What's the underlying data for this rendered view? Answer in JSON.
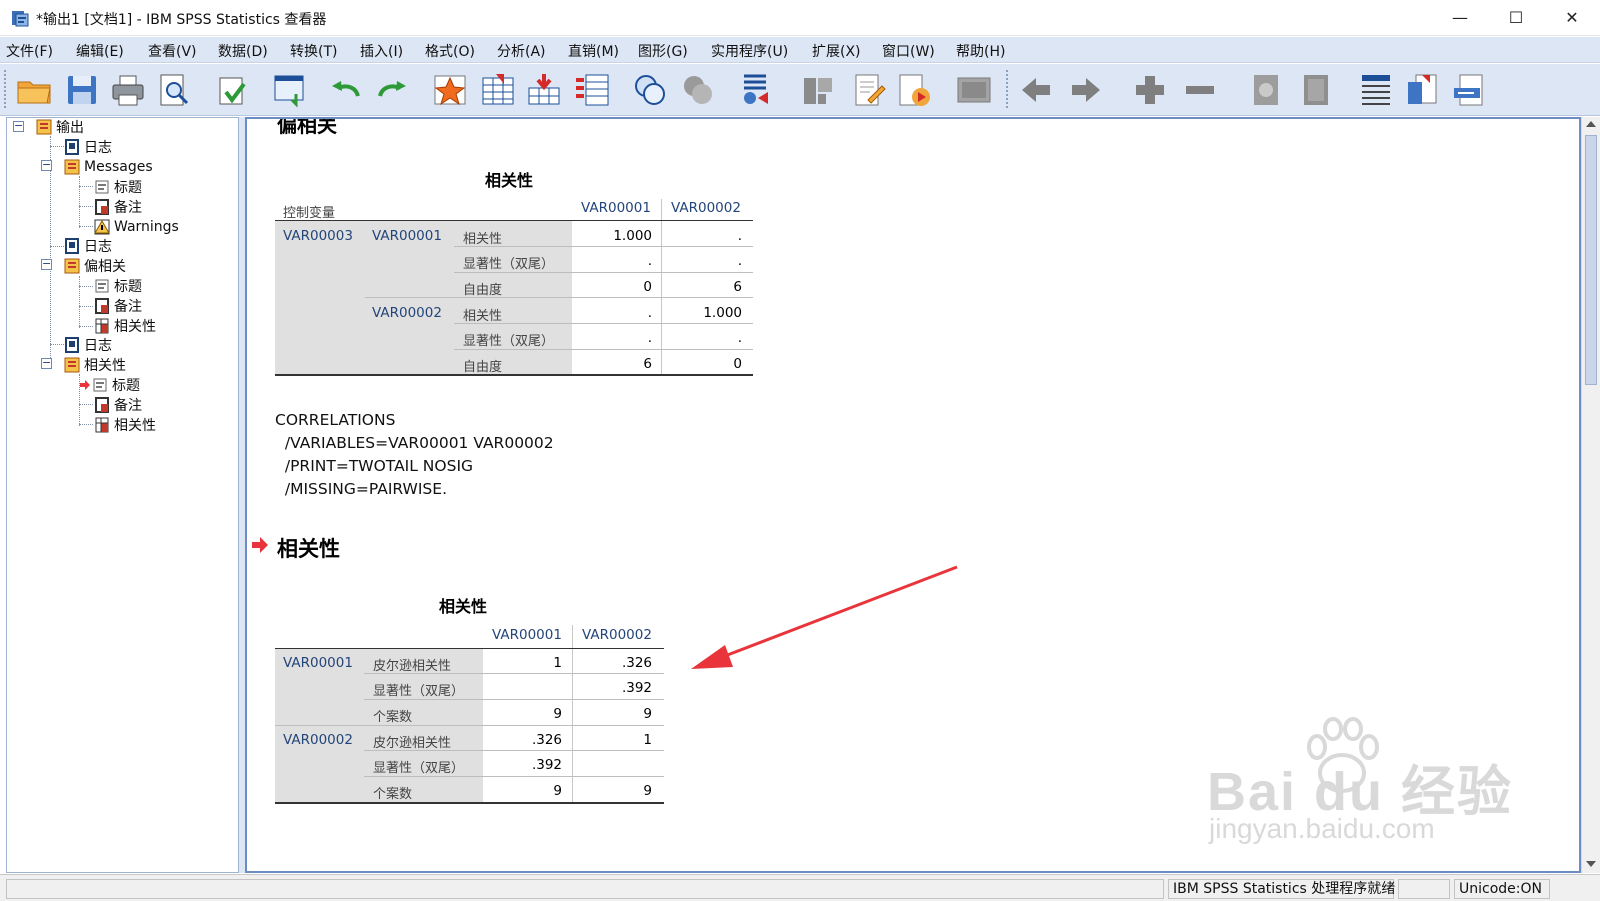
{
  "window": {
    "title": "*输出1 [文档1] - IBM SPSS Statistics 查看器",
    "minimize": "—",
    "maximize": "☐",
    "close": "✕"
  },
  "menu": [
    "文件(F)",
    "编辑(E)",
    "查看(V)",
    "数据(D)",
    "转换(T)",
    "插入(I)",
    "格式(O)",
    "分析(A)",
    "直销(M)",
    "图形(G)",
    "实用程序(U)",
    "扩展(X)",
    "窗口(W)",
    "帮助(H)"
  ],
  "outline": {
    "root": "输出",
    "log1": "日志",
    "messages": "Messages",
    "msg_title": "标题",
    "msg_notes": "备注",
    "msg_warnings": "Warnings",
    "log2": "日志",
    "partial": "偏相关",
    "partial_title": "标题",
    "partial_notes": "备注",
    "partial_corr": "相关性",
    "log3": "日志",
    "corr": "相关性",
    "corr_title": "标题",
    "corr_notes": "备注",
    "corr_corr": "相关性"
  },
  "content": {
    "partial_heading": "偏相关",
    "table1": {
      "title": "相关性",
      "control_label": "控制变量",
      "col1": "VAR00001",
      "col2": "VAR00002",
      "control_var": "VAR00003",
      "row_var1": "VAR00001",
      "row_var2": "VAR00002",
      "stat_corr": "相关性",
      "stat_sig": "显著性（双尾）",
      "stat_df": "自由度",
      "r1": [
        {
          "v1": "1.000",
          "v2": "."
        },
        {
          "v1": ".",
          "v2": "."
        },
        {
          "v1": "0",
          "v2": "6"
        }
      ],
      "r2": [
        {
          "v1": ".",
          "v2": "1.000"
        },
        {
          "v1": ".",
          "v2": "."
        },
        {
          "v1": "6",
          "v2": "0"
        }
      ]
    },
    "syntax": [
      "CORRELATIONS",
      "  /VARIABLES=VAR00001 VAR00002",
      "  /PRINT=TWOTAIL NOSIG",
      "  /MISSING=PAIRWISE."
    ],
    "section_title": "相关性",
    "table2": {
      "title": "相关性",
      "col1": "VAR00001",
      "col2": "VAR00002",
      "row_var1": "VAR00001",
      "row_var2": "VAR00002",
      "stat_pearson": "皮尔逊相关性",
      "stat_sig": "显著性（双尾）",
      "stat_n": "个案数",
      "r1": [
        {
          "v1": "1",
          "v2": ".326"
        },
        {
          "v1": "",
          "v2": ".392"
        },
        {
          "v1": "9",
          "v2": "9"
        }
      ],
      "r2": [
        {
          "v1": ".326",
          "v2": "1"
        },
        {
          "v1": ".392",
          "v2": ""
        },
        {
          "v1": "9",
          "v2": "9"
        }
      ]
    }
  },
  "watermark": {
    "brand": "Bai du 经验",
    "url": "jingyan.baidu.com"
  },
  "status": {
    "processor": "IBM SPSS Statistics 处理程序就绪",
    "unicode": "Unicode:ON"
  },
  "colors": {
    "menu_bg": "#dce6f4",
    "pane_border": "#6c8cc4",
    "label_blue": "#24457a",
    "arrow_red": "#e8343a"
  }
}
